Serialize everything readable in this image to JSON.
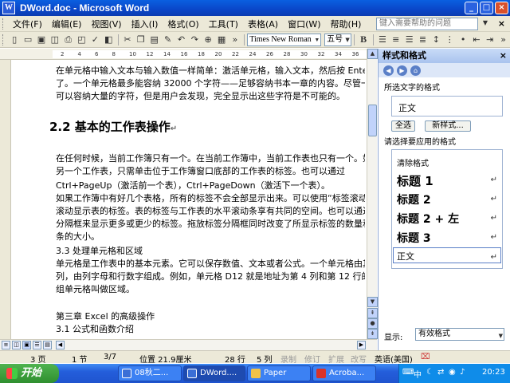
{
  "window": {
    "title": "DWord.doc - Microsoft Word",
    "buttons": {
      "minimize": "_",
      "maximize": "□",
      "close": "×"
    }
  },
  "menu": {
    "items": [
      "文件(F)",
      "编辑(E)",
      "视图(V)",
      "插入(I)",
      "格式(O)",
      "工具(T)",
      "表格(A)",
      "窗口(W)",
      "帮助(H)"
    ],
    "help_placeholder": "键入需要帮助的问题",
    "close": "×"
  },
  "toolbar": {
    "font_name": "Times New Roman",
    "font_size": "五号",
    "bold": "B"
  },
  "ruler": {
    "marks": [
      "2",
      "4",
      "6",
      "8",
      "10",
      "12",
      "14",
      "16",
      "18",
      "20",
      "22",
      "24",
      "26",
      "28",
      "30",
      "32",
      "34",
      "36"
    ]
  },
  "document": {
    "lines_top": [
      "在单元格中输入文本与输入数值一样简单：激活单元格，输入文本，然后按 Ente",
      "了。一个单元格最多能容纳 32000 个字符——足够容纳书本一章的内容。尽管一",
      "可以容纳大量的字符，但是用户会发现，完全显示出这些字符是不可能的。"
    ],
    "heading": "2.2  基本的工作表操作",
    "lines_body": [
      "在任何时候，当前工作簿只有一个。在当前工作簿中，当前工作表也只有一个。如",
      "另一个工作表，只需单击位于工作簿窗口底部的工作表的标签。也可以通过",
      "Ctrl+PageUp（激活前一个表），Ctrl+PageDown（激活下一个表）。",
      "如果工作簿中有好几个表格，所有的标签不会全部显示出来。可以使用“标签滚动",
      "滚动显示表的标签。表的标签与工作表的水平滚动条享有共同的空间。也可以通过",
      "分隔框来显示更多或更少的标签。拖放标签分隔框同时改变了所显示标签的数量和",
      "条的大小。",
      "3.3 处理单元格和区域",
      "单元格是工作表中的基本元素。它可以保存数值、文本或者公式。一个单元格由其",
      "列，由列字母和行数字组成。例如，单元格 D12 就是地址为第 4 列和第 12 行的单",
      "组单元格叫做区域。",
      "",
      "第三章  Excel 的高级操作",
      "3.1 公式和函数介绍"
    ]
  },
  "taskpane": {
    "title": "样式和格式",
    "close": "×",
    "selected_format_label": "所选文字的格式",
    "selected_format_value": "正文",
    "select_all_button": "全选",
    "new_style_button": "新样式...",
    "apply_label": "请选择要应用的格式",
    "styles": [
      {
        "name": "清除格式",
        "kind": "small"
      },
      {
        "name": "标题 1",
        "kind": "h1"
      },
      {
        "name": "标题 2",
        "kind": "h2"
      },
      {
        "name": "标题 2 + 左",
        "kind": "h2"
      },
      {
        "name": "标题 3",
        "kind": "h2"
      },
      {
        "name": "正文",
        "kind": "normal"
      }
    ],
    "show_label": "显示:",
    "show_value": "有效格式"
  },
  "statusbar": {
    "page": "3 页",
    "section": "1 节",
    "page_of": "3/7",
    "position": "位置 21.9厘米",
    "line": "28 行",
    "column": "5 列",
    "rec": "录制",
    "trk": "修订",
    "ext": "扩展",
    "ovr": "改写",
    "language": "英语(美国)"
  },
  "taskbar": {
    "start": "开始",
    "tasks": [
      "08秋二...",
      "DWord....",
      "Paper",
      "Acroba..."
    ],
    "tray_lang": "中",
    "clock": "20:23"
  }
}
